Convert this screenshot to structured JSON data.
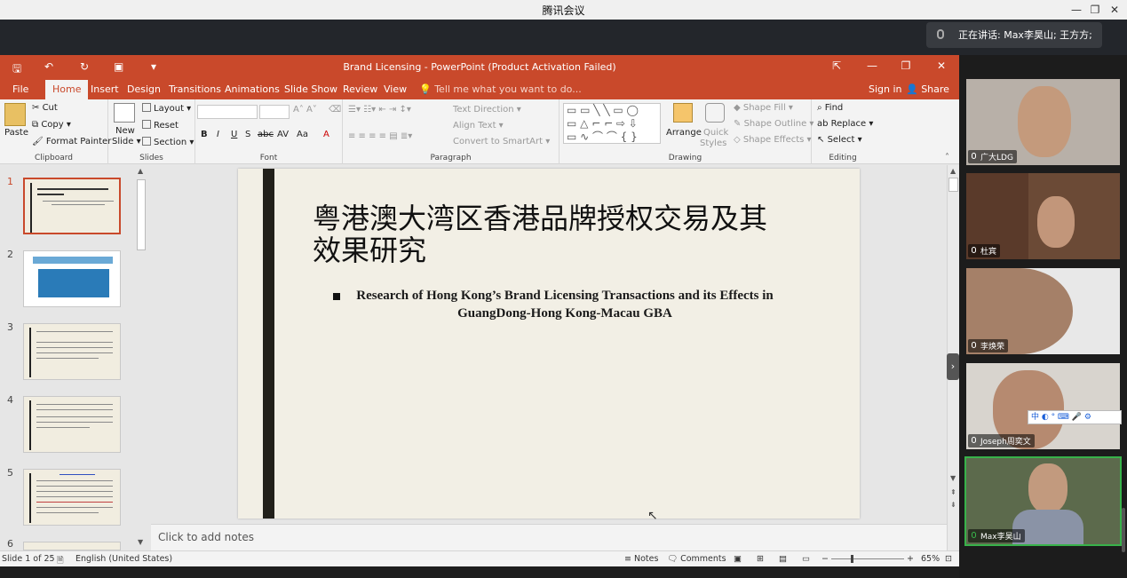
{
  "app": {
    "window_title": "腾讯会议",
    "speaking": "正在讲话: Max李昊山; 王方方;"
  },
  "ppt": {
    "title": "Brand Licensing - PowerPoint (Product Activation Failed)",
    "tabs": [
      "File",
      "Home",
      "Insert",
      "Design",
      "Transitions",
      "Animations",
      "Slide Show",
      "Review",
      "View"
    ],
    "tell_me": "Tell me what you want to do...",
    "sign_in": "Sign in",
    "share": "Share",
    "ribbon": {
      "clipboard": {
        "label": "Clipboard",
        "paste": "Paste",
        "cut": "Cut",
        "copy": "Copy",
        "format_painter": "Format Painter"
      },
      "slides": {
        "label": "Slides",
        "new_slide_1": "New",
        "new_slide_2": "Slide",
        "layout": "Layout",
        "reset": "Reset",
        "section": "Section"
      },
      "font": {
        "label": "Font",
        "bold": "B",
        "italic": "I",
        "underline": "U",
        "shadow": "S",
        "strike": "abc",
        "spacing": "AV",
        "case": "Aa",
        "color": "A"
      },
      "paragraph": {
        "label": "Paragraph",
        "text_direction": "Text Direction",
        "align_text": "Align Text",
        "convert_smartart": "Convert to SmartArt"
      },
      "drawing": {
        "label": "Drawing",
        "arrange": "Arrange",
        "quick_styles_1": "Quick",
        "quick_styles_2": "Styles",
        "shape_fill": "Shape Fill",
        "shape_outline": "Shape Outline",
        "shape_effects": "Shape Effects"
      },
      "editing": {
        "label": "Editing",
        "find": "Find",
        "replace": "Replace",
        "select": "Select"
      }
    },
    "thumbnails": [
      {
        "num": "1",
        "selected": true
      },
      {
        "num": "2",
        "selected": false
      },
      {
        "num": "3",
        "selected": false
      },
      {
        "num": "4",
        "selected": false
      },
      {
        "num": "5",
        "selected": false
      },
      {
        "num": "6",
        "selected": false
      }
    ],
    "slide": {
      "title": "粤港澳大湾区香港品牌授权交易及其效果研究",
      "subtitle": "Research of Hong Kong’s Brand Licensing Transactions and its Effects in GuangDong-Hong Kong-Macau GBA"
    },
    "notes_placeholder": "Click to add notes",
    "status": {
      "slide_count": "Slide 1 of 25",
      "language": "English (United States)",
      "notes": "Notes",
      "comments": "Comments",
      "zoom": "65%"
    }
  },
  "participants": [
    {
      "name": "广大LDG",
      "active": false
    },
    {
      "name": "杜宾",
      "active": false
    },
    {
      "name": "李焕荣",
      "active": false
    },
    {
      "name": "Joseph周奕文",
      "active": false
    },
    {
      "name": "Max李昊山",
      "active": true
    }
  ],
  "ime_bar": "中 ◐ ° ⌨ 🎤 ⚙"
}
